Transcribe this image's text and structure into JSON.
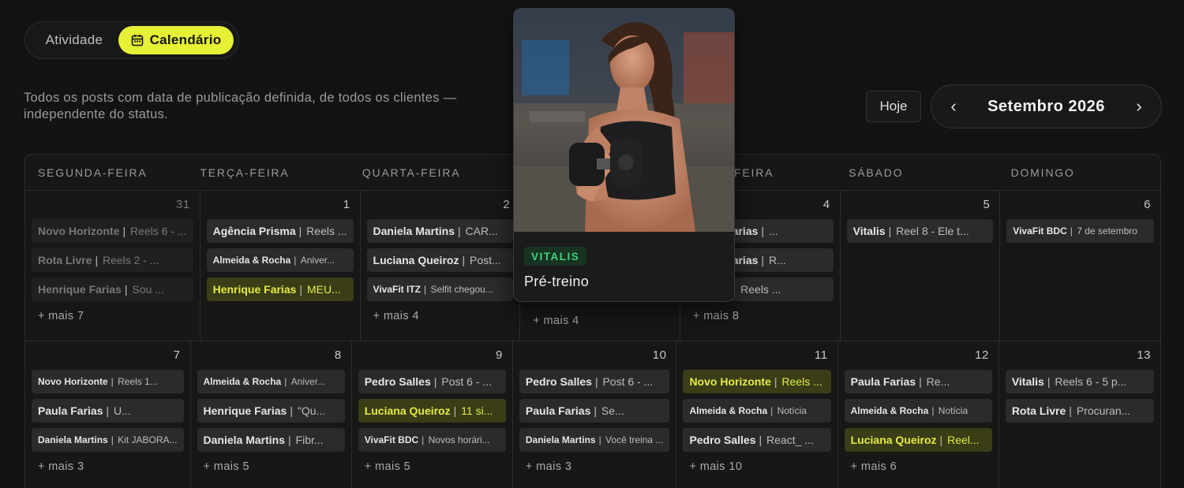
{
  "view_toggle": {
    "activity": "Atividade",
    "calendar": "Calendário"
  },
  "description": "Todos os posts com data de publicação definida, de todos os clientes — independente do status.",
  "today_button": "Hoje",
  "month_label": "Setembro 2026",
  "weekdays": [
    "SEGUNDA-FEIRA",
    "TERÇA-FEIRA",
    "QUARTA-FEIRA",
    "QUINTA-FEIRA",
    "SEXTA-FEIRA",
    "SÁBADO",
    "DOMINGO"
  ],
  "weeks": [
    [
      {
        "num": "31",
        "out": true,
        "posts": [
          {
            "name": "Novo Horizonte",
            "text": "Reels 6 - ...",
            "style": "dim"
          },
          {
            "name": "Rota Livre",
            "text": "Reels 2 - ...",
            "style": "dim"
          },
          {
            "name": "Henrique Farias",
            "text": "Sou ...",
            "style": "dim"
          }
        ],
        "more": "+ mais 7"
      },
      {
        "num": "1",
        "posts": [
          {
            "name": "Agência Prisma",
            "text": "Reels ..."
          },
          {
            "name": "Almeida & Rocha",
            "text": "Aniver...",
            "style": "small"
          },
          {
            "name": "Henrique Farias",
            "text": "MEU...",
            "style": "hl"
          }
        ],
        "more": ""
      },
      {
        "num": "2",
        "posts": [
          {
            "name": "Daniela Martins",
            "text": "CAR..."
          },
          {
            "name": "Luciana Queiroz",
            "text": "Post..."
          },
          {
            "name": "VivaFit ITZ",
            "text": "Selfit chegou...",
            "style": "small"
          }
        ],
        "more": "+ mais 4"
      },
      {
        "num": "3",
        "posts": [],
        "more": "+ mais 4"
      },
      {
        "num": "4",
        "posts": [
          {
            "name": "Paula Farias",
            "text": "..."
          },
          {
            "name": "Paula Farias",
            "text": "R..."
          },
          {
            "name": "Prisma",
            "text": "Reels ..."
          }
        ],
        "more": "+ mais 8"
      },
      {
        "num": "5",
        "posts": [
          {
            "name": "Vitalis",
            "text": "Reel 8 - Ele t..."
          }
        ],
        "more": ""
      },
      {
        "num": "6",
        "posts": [
          {
            "name": "VivaFit BDC",
            "text": "7 de setembro",
            "style": "small"
          }
        ],
        "more": ""
      }
    ],
    [
      {
        "num": "7",
        "posts": [
          {
            "name": "Novo Horizonte",
            "text": "Reels 1...",
            "style": "small"
          },
          {
            "name": "Paula Farias",
            "text": "U..."
          },
          {
            "name": "Daniela Martins",
            "text": "Kit JABORA...",
            "style": "small"
          }
        ],
        "more": "+ mais 3"
      },
      {
        "num": "8",
        "posts": [
          {
            "name": "Almeida & Rocha",
            "text": "Aniver...",
            "style": "small"
          },
          {
            "name": "Henrique Farias",
            "text": "\"Qu..."
          },
          {
            "name": "Daniela Martins",
            "text": "Fibr..."
          }
        ],
        "more": "+ mais 5"
      },
      {
        "num": "9",
        "posts": [
          {
            "name": "Pedro Salles",
            "text": "Post 6 - ..."
          },
          {
            "name": "Luciana Queiroz",
            "text": "11 si...",
            "style": "hl"
          },
          {
            "name": "VivaFit BDC",
            "text": "Novos horári...",
            "style": "small"
          }
        ],
        "more": "+ mais 5"
      },
      {
        "num": "10",
        "posts": [
          {
            "name": "Pedro Salles",
            "text": "Post 6 - ..."
          },
          {
            "name": "Paula Farias",
            "text": "Se..."
          },
          {
            "name": "Daniela Martins",
            "text": "Você treina ...",
            "style": "small"
          }
        ],
        "more": "+ mais 3"
      },
      {
        "num": "11",
        "posts": [
          {
            "name": "Novo Horizonte",
            "text": "Reels ...",
            "style": "hl"
          },
          {
            "name": "Almeida & Rocha",
            "text": "Notícia",
            "style": "small"
          },
          {
            "name": "Pedro Salles",
            "text": "React_ ..."
          }
        ],
        "more": "+ mais 10"
      },
      {
        "num": "12",
        "posts": [
          {
            "name": "Paula Farias",
            "text": "Re..."
          },
          {
            "name": "Almeida & Rocha",
            "text": "Notícia",
            "style": "small"
          },
          {
            "name": "Luciana Queiroz",
            "text": "Reel...",
            "style": "hl"
          }
        ],
        "more": "+ mais 6"
      },
      {
        "num": "13",
        "posts": [
          {
            "name": "Vitalis",
            "text": "Reels 6 - 5 p..."
          },
          {
            "name": "Rota Livre",
            "text": "Procuran..."
          }
        ],
        "more": ""
      }
    ]
  ],
  "popover": {
    "tag": "VITALIS",
    "title": "Pré-treino",
    "image": "woman-lifting-dumbbell-gym-photo"
  },
  "colors": {
    "accent": "#e6f034",
    "tag_green": "#3fd27e",
    "background": "#131313"
  }
}
